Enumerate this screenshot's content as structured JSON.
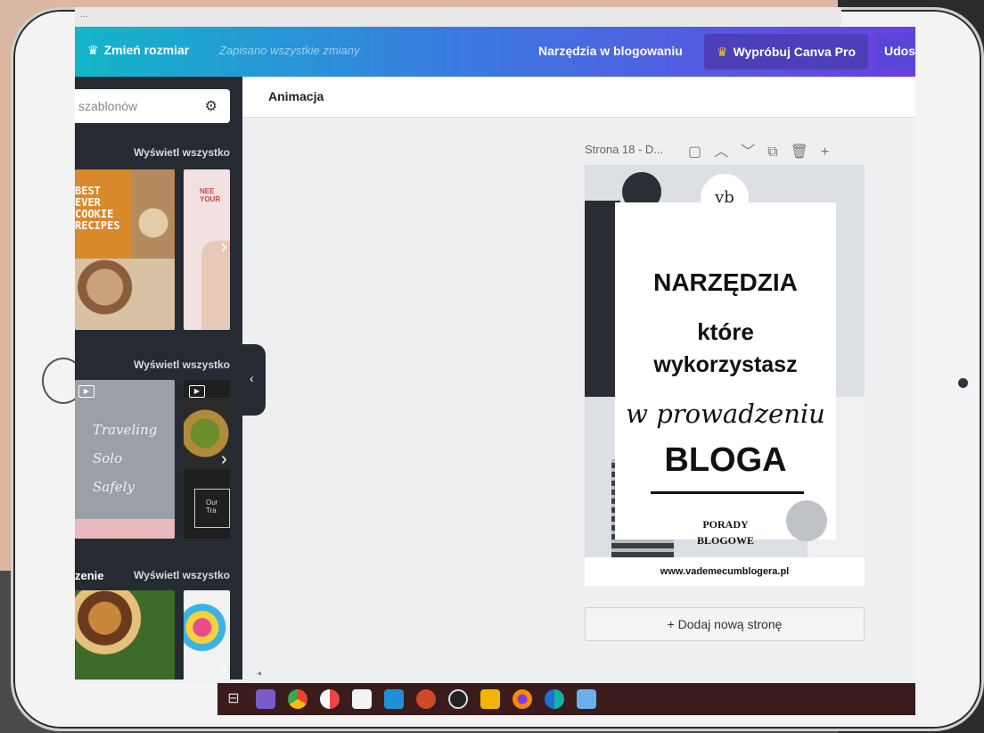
{
  "url_strip": "...",
  "topbar": {
    "resize_label": "Zmień rozmiar",
    "saved_status": "Zapisano wszystkie zmiany",
    "tools_label": "Narzędzia w blogowaniu",
    "pro_label": "Wypróbuj Canva Pro",
    "share_label": "Udos",
    "crown_glyph": "♛"
  },
  "sidebar": {
    "search_placeholder": "szablonów",
    "sections": [
      {
        "title": "",
        "link": "Wyświetl wszystko"
      },
      {
        "title": "",
        "link": "Wyświetl wszystko"
      },
      {
        "title": "zenie",
        "link": "Wyświetl wszystko"
      }
    ],
    "cookie_text": "BEST EVER COOKIE RECIPES",
    "pink_text": "NEE YOUR",
    "gray_text": "Traveling Solo Safely",
    "dark_text": "Our Tra"
  },
  "subbar": {
    "animation_label": "Animacja"
  },
  "page": {
    "label": "Strona 18 - D...",
    "add_page": "+ Dodaj nową stronę"
  },
  "poster": {
    "logo": "vb",
    "line1": "NARZĘDZIA",
    "line2": "które",
    "line3": "wykorzystasz",
    "line4": "w prowadzeniu",
    "line5": "BLOGA",
    "line6a": "PORADY",
    "line6b": "BLOGOWE",
    "footer": "www.vademecumblogera.pl"
  },
  "taskbar_icons": [
    "task-view-icon",
    "app-icon",
    "chrome-icon",
    "app-icon",
    "store-icon",
    "mail-icon",
    "powerpoint-icon",
    "obs-icon",
    "explorer-icon",
    "firefox-icon",
    "edge-icon",
    "photos-icon"
  ]
}
